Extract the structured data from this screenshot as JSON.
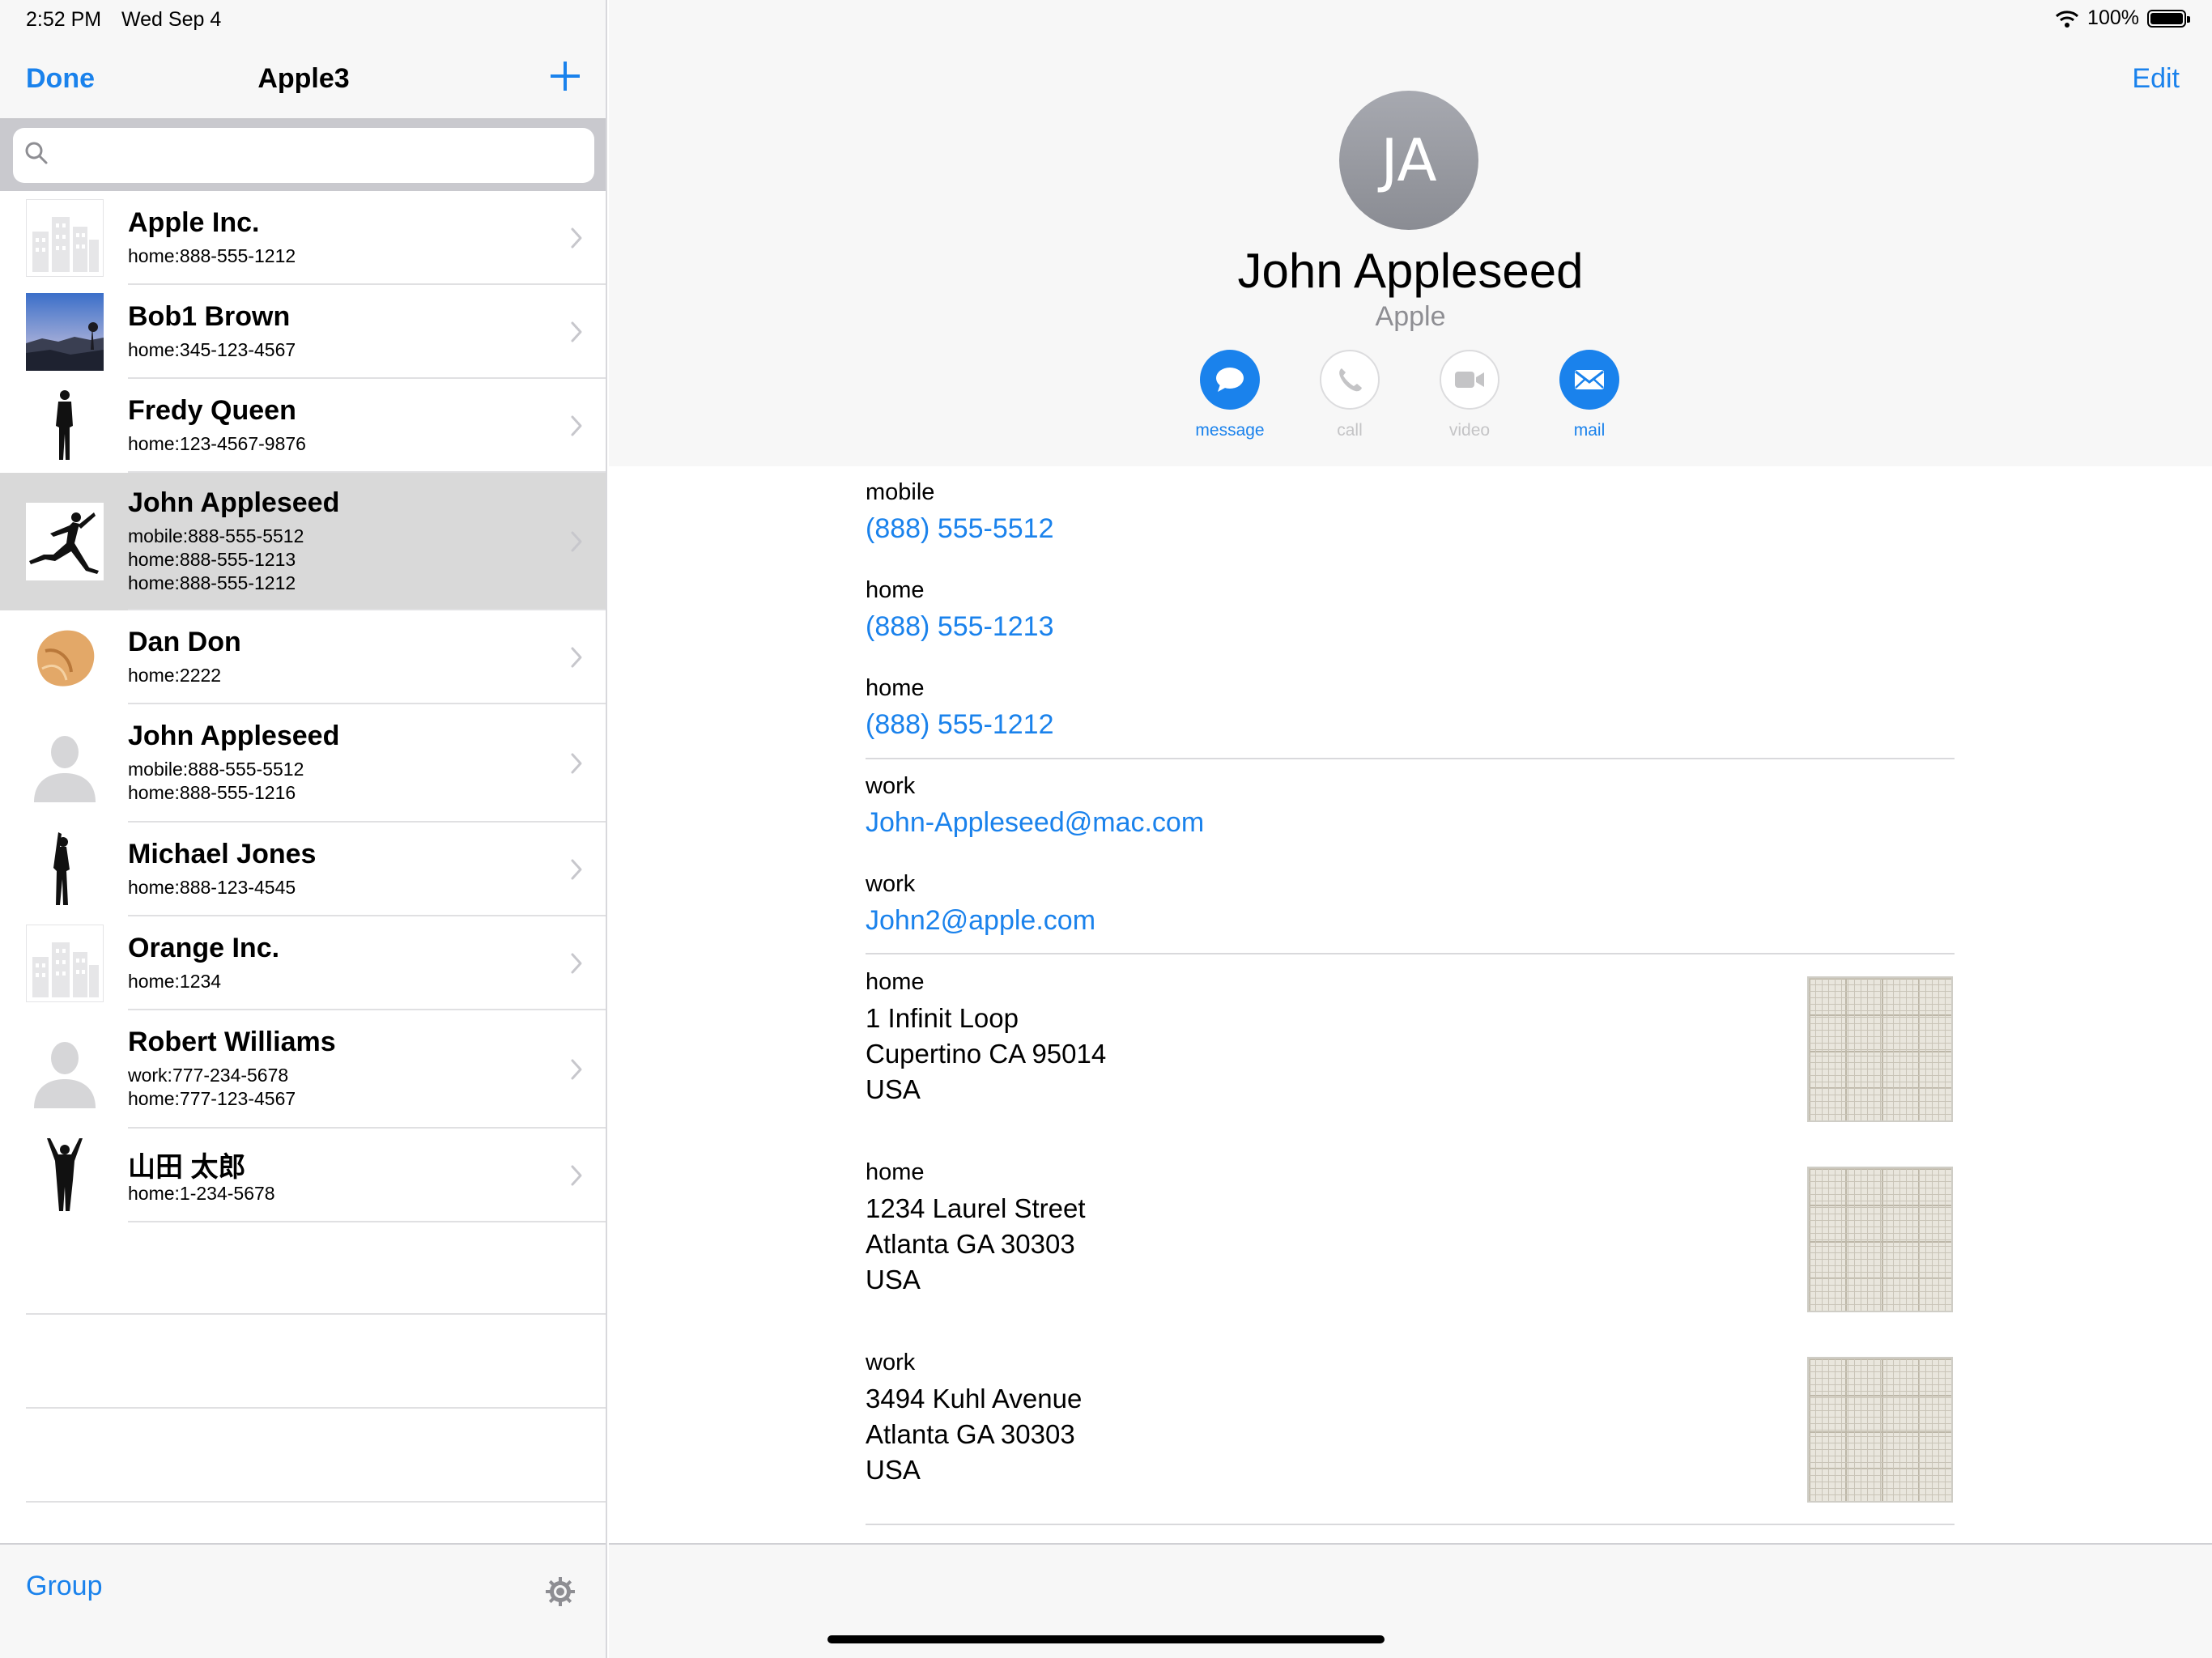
{
  "status_bar": {
    "time": "2:52 PM",
    "date": "Wed Sep 4",
    "battery": "100%"
  },
  "left_pane": {
    "done_label": "Done",
    "title": "Apple3",
    "search": {
      "placeholder": "",
      "value": ""
    },
    "group_label": "Group",
    "contacts": [
      {
        "name": "Apple Inc.",
        "phones": [
          "home:888-555-1212"
        ],
        "thumb": "building-icon",
        "selected": false
      },
      {
        "name": "Bob1 Brown",
        "phones": [
          "home:345-123-4567"
        ],
        "thumb": "landscape-photo",
        "selected": false
      },
      {
        "name": "Fredy Queen",
        "phones": [
          "home:123-4567-9876"
        ],
        "thumb": "standing-silhouette",
        "selected": false
      },
      {
        "name": "John Appleseed",
        "phones": [
          "mobile:888-555-5512",
          "home:888-555-1213",
          "home:888-555-1212"
        ],
        "thumb": "jumping-silhouette",
        "selected": true
      },
      {
        "name": "Dan Don",
        "phones": [
          "home:2222"
        ],
        "thumb": "fortune-cookie-photo",
        "selected": false
      },
      {
        "name": "John Appleseed",
        "phones": [
          "mobile:888-555-5512",
          "home:888-555-1216"
        ],
        "thumb": "person-placeholder-icon",
        "selected": false
      },
      {
        "name": "Michael Jones",
        "phones": [
          "home:888-123-4545"
        ],
        "thumb": "pointing-silhouette",
        "selected": false
      },
      {
        "name": "Orange Inc.",
        "phones": [
          "home:1234"
        ],
        "thumb": "building-icon",
        "selected": false
      },
      {
        "name": "Robert Williams",
        "phones": [
          "work:777-234-5678",
          "home:777-123-4567"
        ],
        "thumb": "person-placeholder-icon",
        "selected": false
      },
      {
        "name": "山田 太郎",
        "phones": [
          "home:1-234-5678"
        ],
        "thumb": "arms-up-silhouette",
        "selected": false
      }
    ]
  },
  "detail": {
    "edit_label": "Edit",
    "initials": "JA",
    "name": "John Appleseed",
    "organization": "Apple",
    "actions": [
      {
        "label": "message",
        "icon": "message-bubble-icon",
        "enabled": true
      },
      {
        "label": "call",
        "icon": "phone-icon",
        "enabled": false
      },
      {
        "label": "video",
        "icon": "video-camera-icon",
        "enabled": false
      },
      {
        "label": "mail",
        "icon": "envelope-icon",
        "enabled": true
      }
    ],
    "phones": [
      {
        "label": "mobile",
        "value": "(888) 555-5512"
      },
      {
        "label": "home",
        "value": "(888) 555-1213"
      },
      {
        "label": "home",
        "value": "(888) 555-1212"
      }
    ],
    "emails": [
      {
        "label": "work",
        "value": "John-Appleseed@mac.com"
      },
      {
        "label": "work",
        "value": "John2@apple.com"
      }
    ],
    "addresses": [
      {
        "label": "home",
        "street": "1 Infinit Loop",
        "city_line": "Cupertino CA 95014",
        "country": "USA"
      },
      {
        "label": "home",
        "street": "1234 Laurel Street",
        "city_line": "Atlanta GA 30303",
        "country": "USA"
      },
      {
        "label": "work",
        "street": "3494 Kuhl Avenue",
        "city_line": "Atlanta GA 30303",
        "country": "USA"
      }
    ]
  },
  "colors": {
    "accent": "#1a82ec",
    "selected_row": "#d9d9d9",
    "avatar": "#9a9ca3",
    "secondary_text": "#8e8e93"
  }
}
